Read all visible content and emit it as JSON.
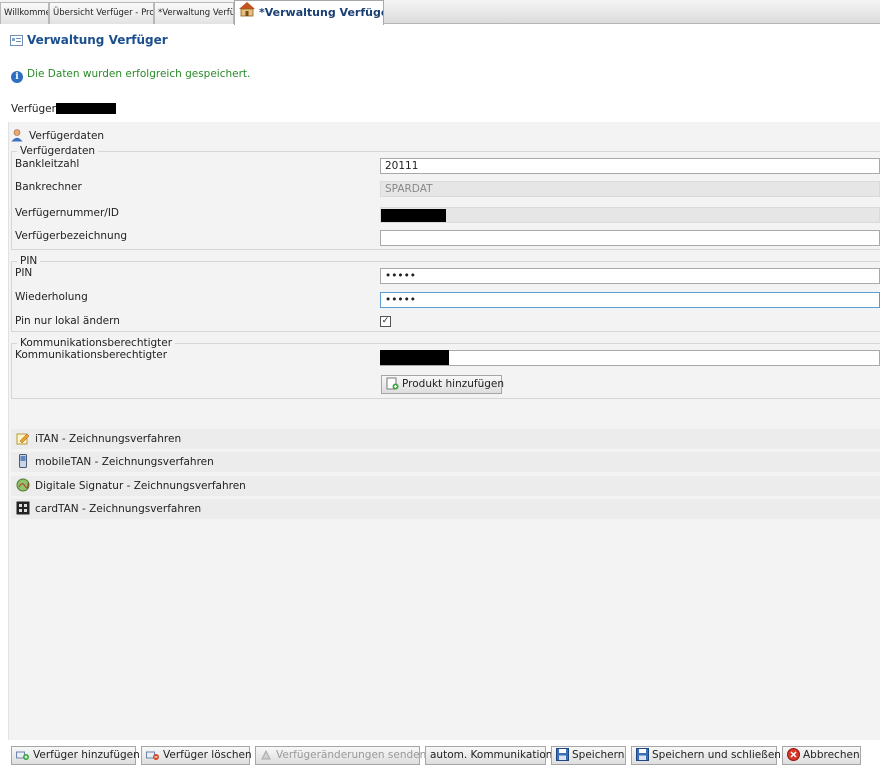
{
  "tabs": [
    {
      "label": "Willkommen"
    },
    {
      "label": "Übersicht Verfüger - Produkte"
    },
    {
      "label": "*Verwaltung Verfüger"
    },
    {
      "label": "*Verwaltung Verfüger",
      "close": "⊠"
    }
  ],
  "page": {
    "title": "Verwaltung Verfüger",
    "message": "Die Daten wurden erfolgreich gespeichert.",
    "verfueger_label": "Verfüger"
  },
  "verfuegerdaten": {
    "section_title": "Verfügerdaten",
    "legend": "Verfügerdaten",
    "bankleitzahl_label": "Bankleitzahl",
    "bankleitzahl_value": "20111",
    "bankrechner_label": "Bankrechner",
    "bankrechner_value": "SPARDAT",
    "nummer_label": "Verfügernummer/ID",
    "bezeichnung_label": "Verfügerbezeichnung",
    "bezeichnung_value": ""
  },
  "pin": {
    "legend": "PIN",
    "pin_label": "PIN",
    "pin_value": "•••••",
    "wiederholung_label": "Wiederholung",
    "wiederholung_value": "•••••",
    "lokal_label": "Pin nur lokal ändern",
    "lokal_checked": "✓"
  },
  "kommunikation": {
    "legend": "Kommunikationsberechtigter",
    "label": "Kommunikationsberechtigter",
    "add_button": "Produkt hinzufügen"
  },
  "verfahren": [
    {
      "label": "iTAN - Zeichnungsverfahren",
      "icon": "pencil-icon"
    },
    {
      "label": "mobileTAN - Zeichnungsverfahren",
      "icon": "mobile-phone-icon"
    },
    {
      "label": "Digitale Signatur - Zeichnungsverfahren",
      "icon": "signature-icon"
    },
    {
      "label": "cardTAN - Zeichnungsverfahren",
      "icon": "card-reader-icon"
    }
  ],
  "buttons": {
    "add": "Verfüger hinzufügen",
    "delete": "Verfüger löschen",
    "send": "Verfügeränderungen senden",
    "auto": "autom. Kommunikation",
    "save": "Speichern",
    "save_close": "Speichern und schließen",
    "cancel": "Abbrechen"
  },
  "colors": {
    "title": "#1c4f8e",
    "success": "#2a8a2a",
    "panel": "#f3f3f3"
  }
}
